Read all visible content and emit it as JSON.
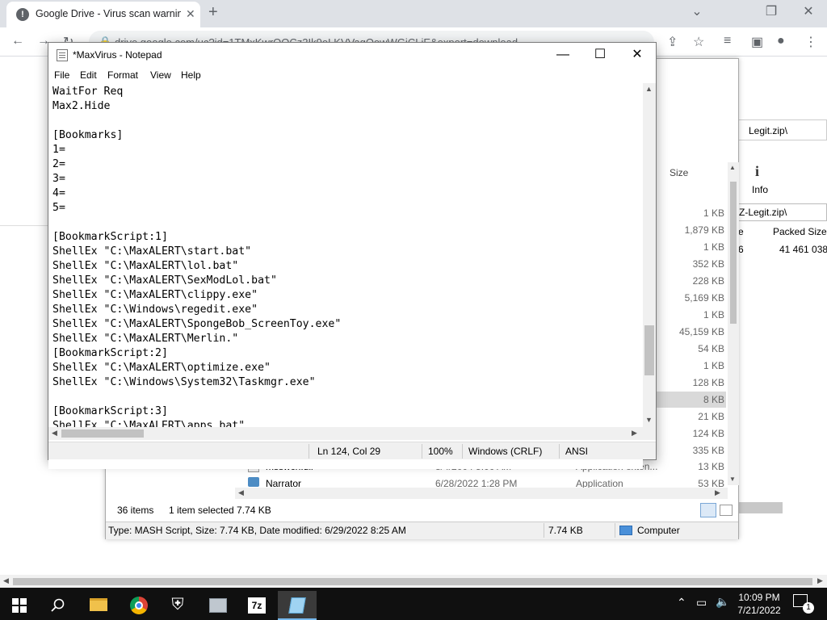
{
  "chrome": {
    "tab_title": "Google Drive - Virus scan warning",
    "url": "drive.google.com/uc?id=1TMxKwrOOCz2Ik9oLKVVagQowWGiCLjE&export=download"
  },
  "explorer": {
    "size_header": "Size",
    "sizes": [
      "1 KB",
      "1,879 KB",
      "1 KB",
      "352 KB",
      "228 KB",
      "5,169 KB",
      "1 KB",
      "45,159 KB",
      "54 KB",
      "1 KB",
      "128 KB",
      "8 KB",
      "21 KB",
      "124 KB",
      "335 KB",
      "13 KB",
      "53 KB"
    ],
    "files": [
      {
        "name": "msswch.dll",
        "date": "8/4/2004 5:00 AM",
        "type": "Application exten...",
        "size": "13 KB"
      },
      {
        "name": "Narrator",
        "date": "6/28/2022 1:28 PM",
        "type": "Application",
        "size": "53 KB"
      }
    ],
    "items_count": "36 items",
    "selection": "1 item selected  7.74 KB",
    "details_text": "Type: MASH Script, Size: 7.74 KB, Date modified: 6/29/2022 8:25 AM",
    "details_size": "7.74 KB",
    "details_location": "Computer"
  },
  "sevenzip": {
    "info_label": "Info",
    "path_top": "Legit.zip\\",
    "path": "Z-Legit.zip\\",
    "packed_header": "Packed Size",
    "packed_value": "41 461 038",
    "partial_col": "e",
    "partial_val": "6"
  },
  "notepad": {
    "title": "*MaxVirus - Notepad",
    "menu": [
      "File",
      "Edit",
      "Format",
      "View",
      "Help"
    ],
    "lines": [
      "WaitFor Req",
      "Max2.Hide",
      "",
      "[Bookmarks]",
      "1=",
      "2=",
      "3=",
      "4=",
      "5=",
      "",
      "[BookmarkScript:1]",
      "ShellEx \"C:\\MaxALERT\\start.bat\"",
      "ShellEx \"C:\\MaxALERT\\lol.bat\"",
      "ShellEx \"C:\\MaxALERT\\SexModLol.bat\"",
      "ShellEx \"C:\\MaxALERT\\clippy.exe\"",
      "ShellEx \"C:\\Windows\\regedit.exe\"",
      "ShellEx \"C:\\MaxALERT\\SpongeBob_ScreenToy.exe\"",
      "ShellEx \"C:\\MaxALERT\\Merlin.\"",
      "[BookmarkScript:2]",
      "ShellEx \"C:\\MaxALERT\\optimize.exe\"",
      "ShellEx \"C:\\Windows\\System32\\Taskmgr.exe\"",
      "",
      "[BookmarkScript:3]",
      "ShellEx \"C:\\MaxALERT\\apps.bat\""
    ],
    "status": {
      "position": "Ln 124, Col 29",
      "zoom": "100%",
      "line_ending": "Windows (CRLF)",
      "encoding": "ANSI"
    }
  },
  "taskbar": {
    "time": "10:09 PM",
    "date": "7/21/2022",
    "notification_count": "1"
  }
}
